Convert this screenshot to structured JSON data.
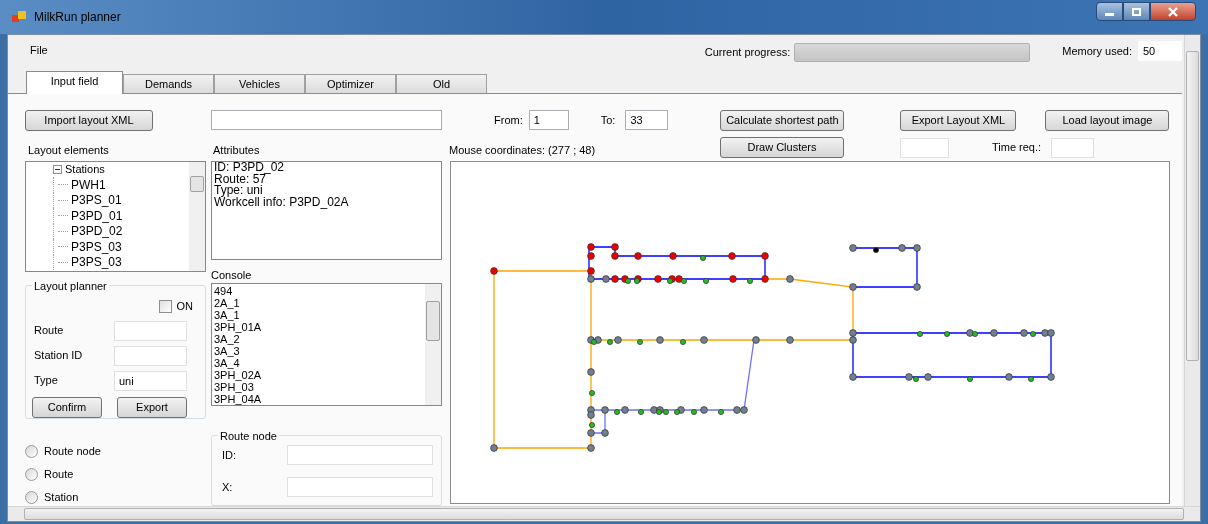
{
  "window": {
    "title": "MilkRun planner"
  },
  "menu": [
    "File"
  ],
  "progress": {
    "label": "Current progress:",
    "level": 0
  },
  "memory": {
    "label": "Memory used:",
    "value": "50"
  },
  "tabs": [
    {
      "label": "Input field",
      "selected": true
    },
    {
      "label": "Demands",
      "selected": false
    },
    {
      "label": "Vehicles",
      "selected": false
    },
    {
      "label": "Optimizer",
      "selected": false
    },
    {
      "label": "Old",
      "selected": false
    }
  ],
  "toolbar": {
    "import_button": "Import layout XML",
    "from_label": "From:",
    "from_value": "1",
    "to_label": "To:",
    "to_value": "33",
    "calc_button": "Calculate shortest path",
    "export_button": "Export Layout XML",
    "load_button": "Load layout image",
    "clusters_button": "Draw Clusters",
    "time_label": "Time req.:"
  },
  "layout_elements": {
    "label": "Layout elements",
    "tree": [
      {
        "label": "Stations",
        "expanded": true,
        "children": [
          {
            "label": "PWH1"
          },
          {
            "label": "P3PS_01"
          },
          {
            "label": "P3PD_01"
          },
          {
            "label": "P3PD_02"
          },
          {
            "label": "P3PS_03"
          },
          {
            "label": "P3PS_03"
          }
        ]
      }
    ]
  },
  "attributes": {
    "label": "Attributes",
    "lines": [
      "ID: P3PD_02",
      "Route: 57",
      "Type: uni",
      "Workcell info: P3PD_02A"
    ]
  },
  "mouse_coordinates": "Mouse coordinates: (277 ; 48)",
  "layout_planner": {
    "title": "Layout planner",
    "on_label": "ON",
    "on_checked": false,
    "fields": [
      {
        "label": "Route"
      },
      {
        "label": "Station ID"
      },
      {
        "label": "Type",
        "value": "uni"
      }
    ],
    "buttons": [
      "Confirm",
      "Export"
    ]
  },
  "console": {
    "label": "Console",
    "lines": [
      "494",
      "2A_1",
      "3A_1",
      "3PH_01A",
      "3A_2",
      "3A_3",
      "3A_4",
      "3PH_02A",
      "3PH_03",
      "3PH_04A"
    ]
  },
  "radios": [
    {
      "label": "Route node",
      "selected": false
    },
    {
      "label": "Route",
      "selected": false
    },
    {
      "label": "Station",
      "selected": false
    }
  ],
  "route_node": {
    "title": "Route node",
    "fields": [
      "ID:",
      "X:"
    ]
  }
}
